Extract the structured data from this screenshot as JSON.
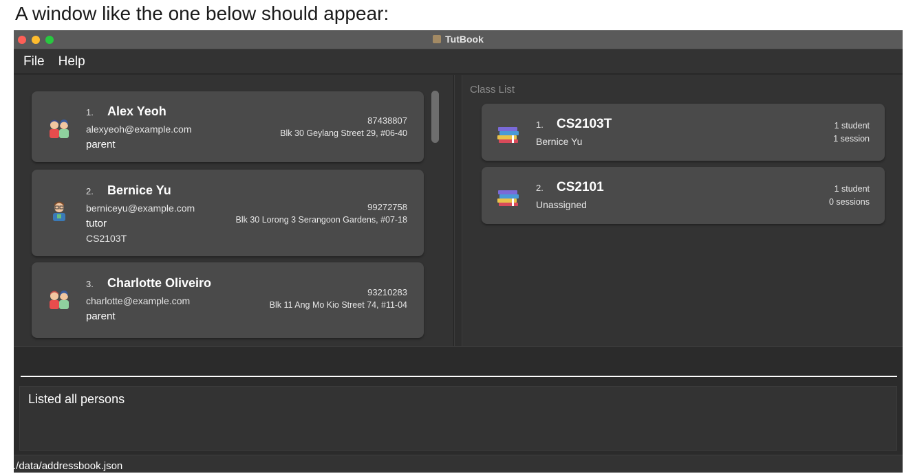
{
  "caption": "A window like the one below should appear:",
  "window": {
    "title": "TutBook"
  },
  "menu": {
    "file": "File",
    "help": "Help"
  },
  "persons": [
    {
      "index": "1.",
      "name": "Alex Yeoh",
      "email": "alexyeoh@example.com",
      "role": "parent",
      "class": "",
      "phone": "87438807",
      "address": "Blk 30 Geylang Street 29, #06-40",
      "avatar": "parent-avatar-icon"
    },
    {
      "index": "2.",
      "name": "Bernice Yu",
      "email": "berniceyu@example.com",
      "role": "tutor",
      "class": "CS2103T",
      "phone": "99272758",
      "address": "Blk 30 Lorong 3 Serangoon Gardens, #07-18",
      "avatar": "tutor-avatar-icon"
    },
    {
      "index": "3.",
      "name": "Charlotte Oliveiro",
      "email": "charlotte@example.com",
      "role": "parent",
      "class": "",
      "phone": "93210283",
      "address": "Blk 11 Ang Mo Kio Street 74, #11-04",
      "avatar": "parent-avatar-icon"
    }
  ],
  "classList": {
    "label": "Class List",
    "classes": [
      {
        "index": "1.",
        "code": "CS2103T",
        "tutor": "Bernice Yu",
        "students": "1 student",
        "sessions": "1 session",
        "icon": "books-icon"
      },
      {
        "index": "2.",
        "code": "CS2101",
        "tutor": "Unassigned",
        "students": "1 student",
        "sessions": "0 sessions",
        "icon": "books-icon"
      }
    ]
  },
  "command": {
    "value": ""
  },
  "result": {
    "text": "Listed all persons"
  },
  "status": {
    "path": "./data/addressbook.json"
  }
}
